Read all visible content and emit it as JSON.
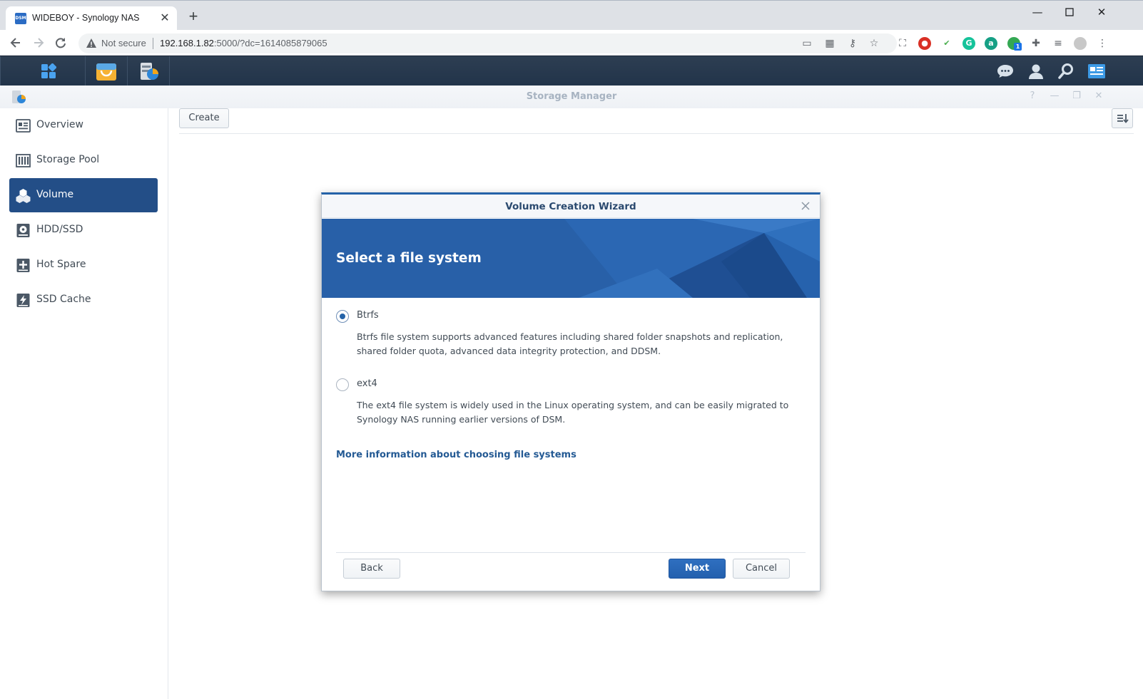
{
  "browser": {
    "tab_title": "WIDEBOY - Synology NAS",
    "tab_favicon": "DSM",
    "security_label": "Not secure",
    "url_host": "192.168.1.82",
    "url_rest": ":5000/?dc=1614085879065",
    "extension_badge": "1"
  },
  "window": {
    "title": "Storage Manager"
  },
  "sidebar": {
    "items": [
      {
        "label": "Overview",
        "icon": "overview-icon"
      },
      {
        "label": "Storage Pool",
        "icon": "storage-pool-icon"
      },
      {
        "label": "Volume",
        "icon": "volume-icon",
        "active": true
      },
      {
        "label": "HDD/SSD",
        "icon": "hdd-icon"
      },
      {
        "label": "Hot Spare",
        "icon": "hot-spare-icon"
      },
      {
        "label": "SSD Cache",
        "icon": "ssd-cache-icon"
      }
    ]
  },
  "toolbar": {
    "create_label": "Create"
  },
  "wizard": {
    "title": "Volume Creation Wizard",
    "heading": "Select a file system",
    "options": [
      {
        "label": "Btrfs",
        "selected": true,
        "description": "Btrfs file system supports advanced features including shared folder snapshots and replication, shared folder quota, advanced data integrity protection, and DDSM."
      },
      {
        "label": "ext4",
        "selected": false,
        "description": "The ext4 file system is widely used in the Linux operating system, and can be easily migrated to Synology NAS running earlier versions of DSM."
      }
    ],
    "more_info_link": "More information about choosing file systems",
    "back_label": "Back",
    "next_label": "Next",
    "cancel_label": "Cancel"
  },
  "colors": {
    "accent": "#2462a8",
    "sidebar_active": "#234e87",
    "taskbar": "#22344a"
  }
}
